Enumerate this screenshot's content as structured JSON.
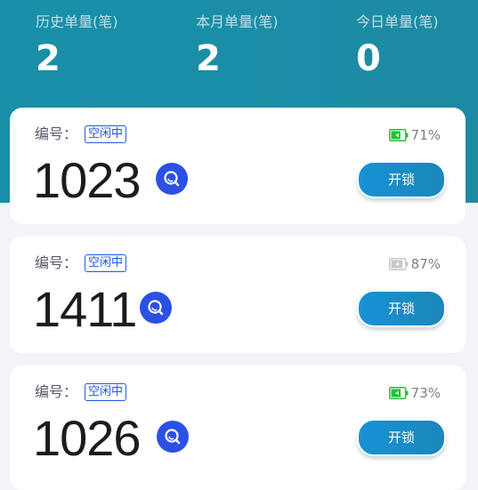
{
  "stats": [
    {
      "label": "历史单量(笔)",
      "value": "2"
    },
    {
      "label": "本月单量(笔)",
      "value": "2"
    },
    {
      "label": "今日单量(笔)",
      "value": "0"
    }
  ],
  "cards": [
    {
      "id_label": "编号：",
      "status": "空闲中",
      "battery_percent": "71%",
      "battery_level": 0.71,
      "battery_color": "#22c233",
      "number": "1023",
      "unlock_label": "开锁"
    },
    {
      "id_label": "编号：",
      "status": "空闲中",
      "battery_percent": "87%",
      "battery_level": 0.87,
      "battery_color": "#c8c8c8",
      "number": "1411",
      "unlock_label": "开锁"
    },
    {
      "id_label": "编号：",
      "status": "空闲中",
      "battery_percent": "73%",
      "battery_level": 0.73,
      "battery_color": "#22c233",
      "number": "1026",
      "unlock_label": "开锁"
    }
  ],
  "colors": {
    "header": "#1a8fa8",
    "accent_blue": "#2b50e6",
    "unlock_button": "#1792d6"
  }
}
